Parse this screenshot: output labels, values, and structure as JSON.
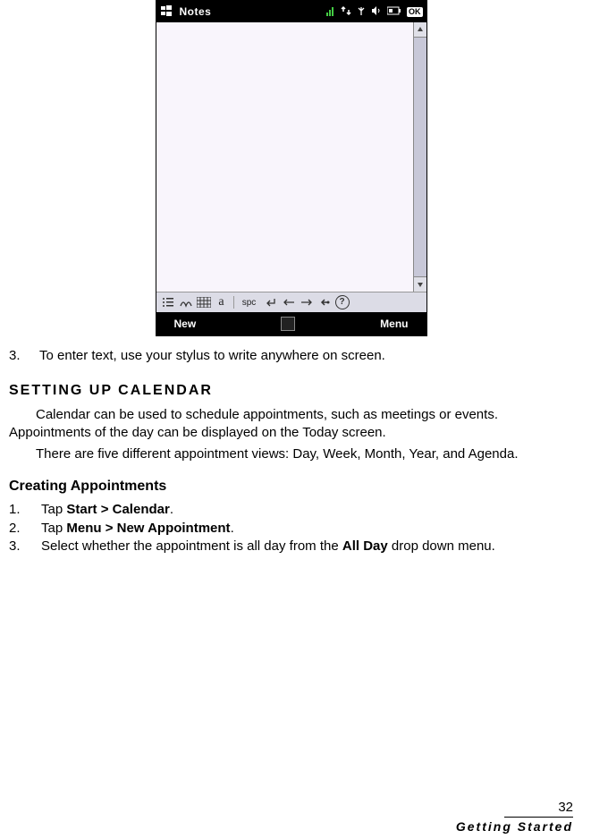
{
  "device": {
    "titlebar": {
      "app_title": "Notes",
      "ok_label": "OK"
    },
    "toolbar": {
      "letter": "a",
      "spc": "spc",
      "help": "?"
    },
    "softkeys": {
      "left": "New",
      "right": "Menu"
    }
  },
  "body": {
    "step3_num": "3.",
    "step3_text": "To enter text, use your stylus to write anywhere on screen.",
    "section_heading": "Setting up Calendar",
    "para1": "Calendar can be used to schedule appointments, such as meetings or events. Appointments of the day can be displayed on the Today screen.",
    "para2": "There are five different appointment views: Day, Week, Month, Year, and Agenda.",
    "sub_heading": "Creating Appointments",
    "steps": [
      {
        "pre": "Tap ",
        "bold": "Start > Calendar",
        "post": "."
      },
      {
        "pre": "Tap ",
        "bold": "Menu > New Appointment",
        "post": "."
      },
      {
        "pre": "Select whether the appointment is all day from the ",
        "bold": "All Day",
        "post": " drop down menu."
      }
    ]
  },
  "footer": {
    "page_number": "32",
    "chapter": "Getting Started"
  }
}
